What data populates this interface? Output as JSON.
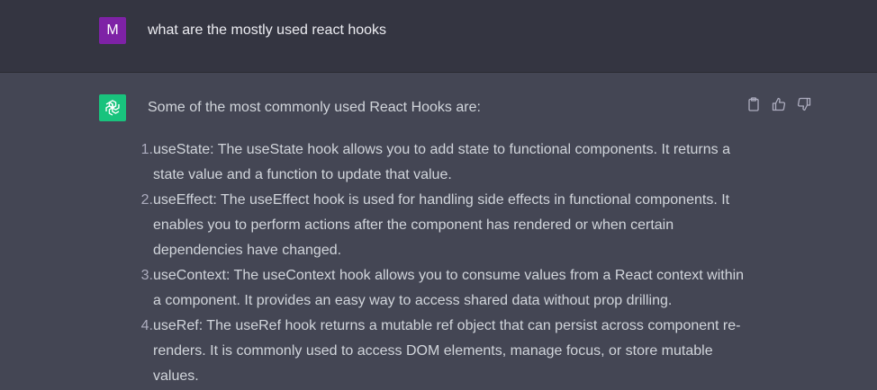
{
  "user_message": {
    "avatar_letter": "M",
    "avatar_color": "#7e22a6",
    "text": "what are the mostly used react hooks"
  },
  "assistant_message": {
    "avatar_color": "#19c37d",
    "avatar_icon": "openai-logo-icon",
    "intro": "Some of the most commonly used React Hooks are:",
    "actions": {
      "copy_icon": "clipboard-icon",
      "thumbs_up_icon": "thumbs-up-icon",
      "thumbs_down_icon": "thumbs-down-icon"
    },
    "items": [
      {
        "number": "1.",
        "text": "useState: The useState hook allows you to add state to functional components. It returns a state value and a function to update that value."
      },
      {
        "number": "2.",
        "text": "useEffect: The useEffect hook is used for handling side effects in functional components. It enables you to perform actions after the component has rendered or when certain dependencies have changed."
      },
      {
        "number": "3.",
        "text": "useContext: The useContext hook allows you to consume values from a React context within a component. It provides an easy way to access shared data without prop drilling."
      },
      {
        "number": "4.",
        "text": "useRef: The useRef hook returns a mutable ref object that can persist across component re-renders. It is commonly used to access DOM elements, manage focus, or store mutable values."
      }
    ]
  }
}
